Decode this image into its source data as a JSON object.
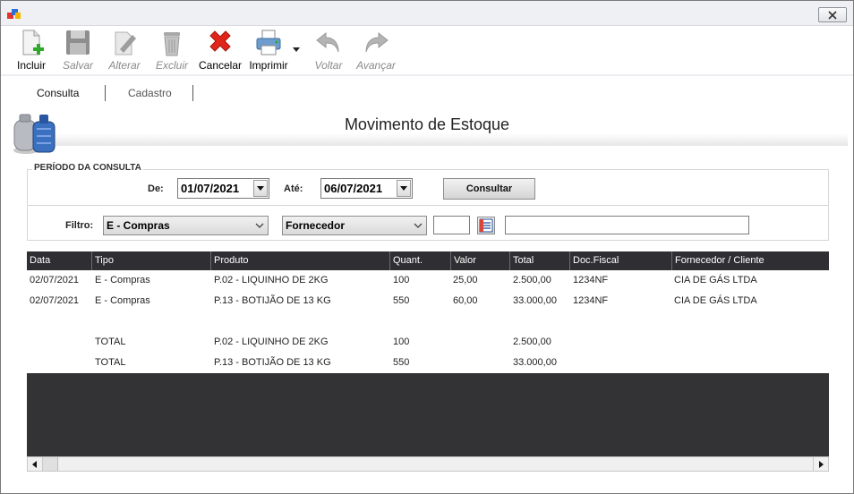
{
  "toolbar": {
    "buttons": [
      {
        "label": "Incluir",
        "icon": "add-document-icon",
        "enabled": true
      },
      {
        "label": "Salvar",
        "icon": "floppy-disk-icon",
        "enabled": false
      },
      {
        "label": "Alterar",
        "icon": "edit-document-icon",
        "enabled": false
      },
      {
        "label": "Excluir",
        "icon": "trash-can-icon",
        "enabled": false
      },
      {
        "label": "Cancelar",
        "icon": "red-x-icon",
        "enabled": true
      },
      {
        "label": "Imprimir",
        "icon": "printer-icon",
        "enabled": true
      },
      {
        "label": "Voltar",
        "icon": "undo-arrow-icon",
        "enabled": false
      },
      {
        "label": "Avançar",
        "icon": "redo-arrow-icon",
        "enabled": false
      }
    ]
  },
  "tabs": [
    {
      "label": "Consulta",
      "active": true
    },
    {
      "label": "Cadastro",
      "active": false
    }
  ],
  "page": {
    "title": "Movimento de Estoque"
  },
  "period": {
    "legend": "PERÍODO DA CONSULTA",
    "from_label": "De:",
    "from_value": "01/07/2021",
    "to_label": "Até:",
    "to_value": "06/07/2021",
    "consult_label": "Consultar"
  },
  "filter": {
    "label": "Filtro:",
    "type_value": "E - Compras",
    "field_value": "Fornecedor",
    "code_value": "",
    "name_value": ""
  },
  "grid": {
    "columns": [
      "Data",
      "Tipo",
      "Produto",
      "Quant.",
      "Valor",
      "Total",
      "Doc.Fiscal",
      "Fornecedor / Cliente"
    ],
    "rows": [
      [
        "02/07/2021",
        "E - Compras",
        "P.02 - LIQUINHO DE 2KG",
        "100",
        "25,00",
        "2.500,00",
        "1234NF",
        "CIA DE GÁS LTDA"
      ],
      [
        "02/07/2021",
        "E - Compras",
        "P.13 - BOTIJÃO DE 13 KG",
        "550",
        "60,00",
        "33.000,00",
        "1234NF",
        "CIA DE GÁS LTDA"
      ],
      [
        "",
        "",
        "",
        "",
        "",
        "",
        "",
        ""
      ],
      [
        "",
        "TOTAL",
        "P.02 - LIQUINHO DE 2KG",
        "100",
        "",
        "2.500,00",
        "",
        ""
      ],
      [
        "",
        "TOTAL",
        "P.13 - BOTIJÃO DE 13 KG",
        "550",
        "",
        "33.000,00",
        "",
        ""
      ]
    ]
  },
  "colors": {
    "grid_header": "#2f2f33",
    "grid_empty": "#333336",
    "cancel_red": "#e0261b",
    "add_green": "#2fa82b"
  }
}
